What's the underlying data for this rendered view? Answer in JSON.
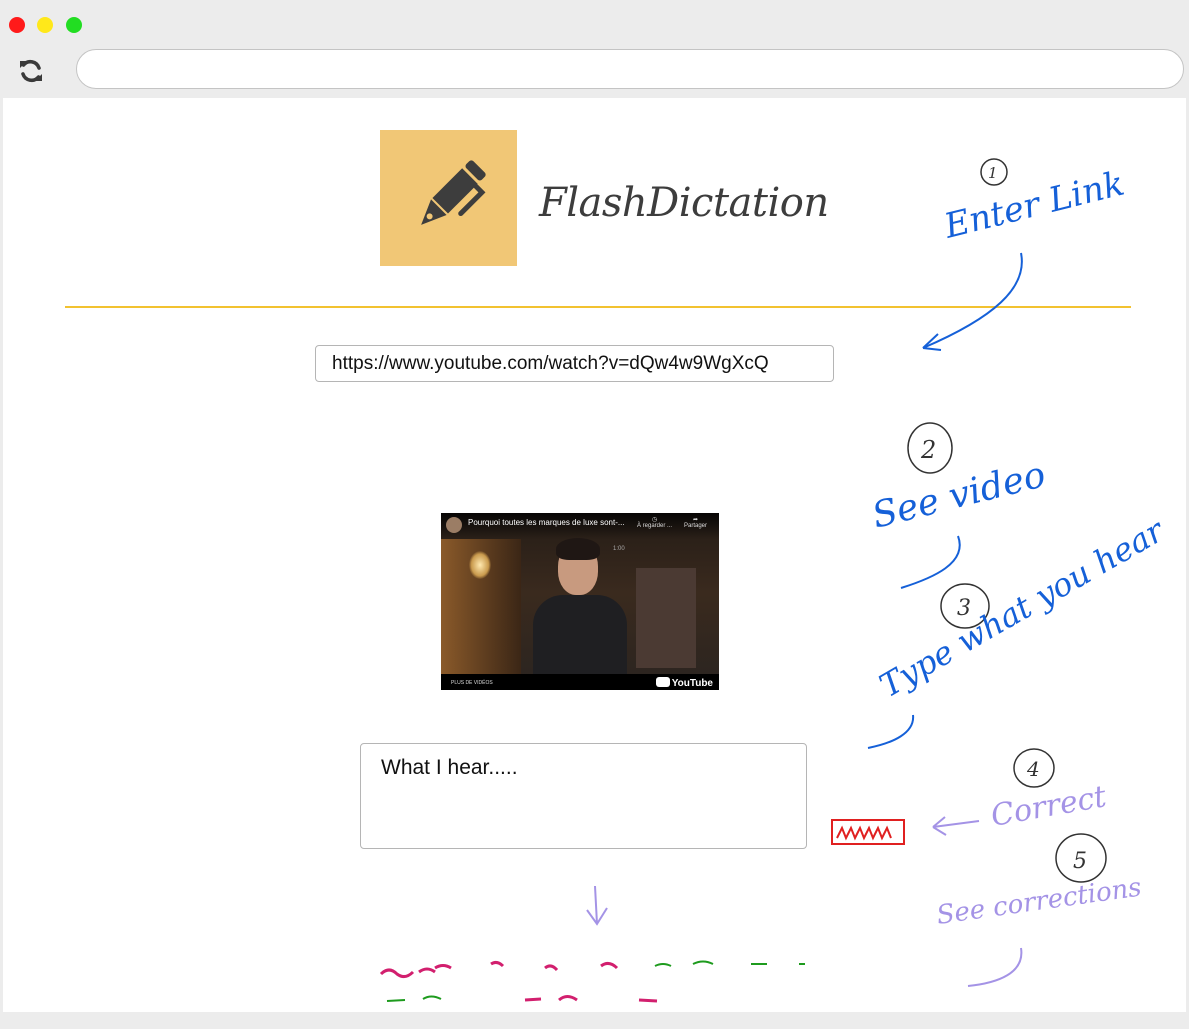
{
  "window": {
    "url_value": "",
    "reload_icon": "refresh-icon"
  },
  "app": {
    "name": "FlashDictation",
    "logo_icon": "pen-icon",
    "colors": {
      "logo_bg": "#f1c776",
      "divider": "#f2c230"
    }
  },
  "link_input": {
    "value": "https://www.youtube.com/watch?v=dQw4w9WgXcQ"
  },
  "video": {
    "title": "Pourquoi toutes les marques de luxe sont-...",
    "watch_later": "À regarder ...",
    "share": "Partager",
    "more_videos": "PLUS DE VIDÉOS",
    "brand": "YouTube",
    "badge": "1:00"
  },
  "answer": {
    "placeholder": "What I hear....."
  },
  "annotations": {
    "step1_num": "1",
    "step1": "Enter Link",
    "step2_num": "2",
    "step2": "See video",
    "step3_num": "3",
    "step3": "Type what you hear",
    "step4_num": "4",
    "step4": "Correct",
    "step5_num": "5",
    "step5": "See corrections"
  }
}
